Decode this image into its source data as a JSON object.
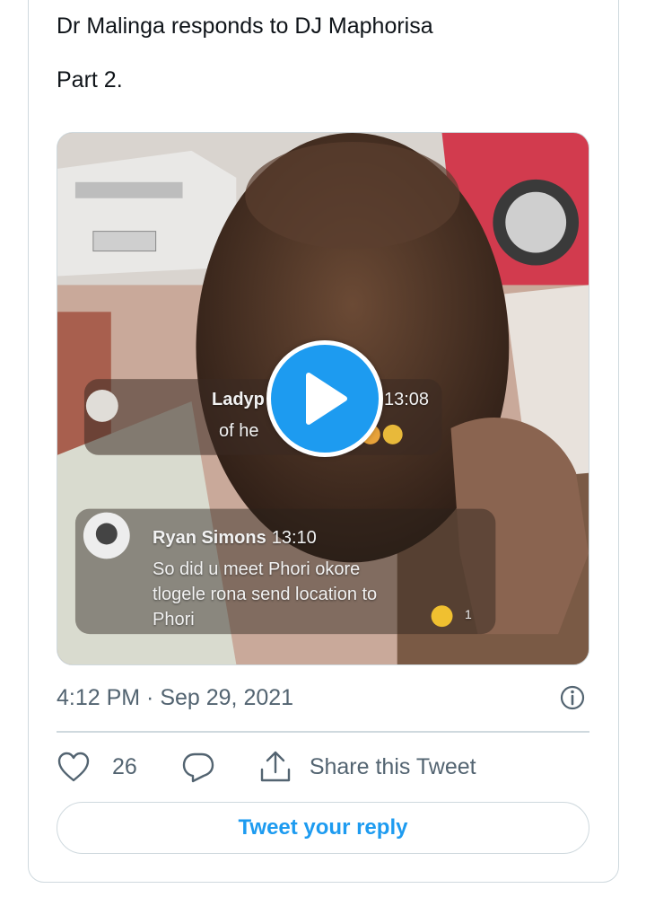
{
  "tweet": {
    "text": "Dr Malinga responds to DJ Maphorisa\n\nPart 2.",
    "timestamp": "4:12 PM · Sep 29, 2021",
    "like_count": "26",
    "share_label": "Share this Tweet",
    "reply_button_label": "Tweet your reply"
  },
  "video": {
    "comments": [
      {
        "name": "Ladyp",
        "time": "13:08",
        "body": "of he"
      },
      {
        "name": "Ryan Simons",
        "time": "13:10",
        "body_line1": "So did u meet Phori okore",
        "body_line2": "tlogele rona send location to",
        "body_line3": "Phori",
        "reaction_count": "1"
      }
    ]
  },
  "icons": {
    "play": "play-icon",
    "info": "info-icon",
    "like": "heart-icon",
    "reply": "reply-bubble-icon",
    "share": "share-upload-icon"
  },
  "colors": {
    "accent": "#1d9bf0",
    "text": "#0f1419",
    "secondary": "#536471",
    "border": "#cfd9de"
  }
}
